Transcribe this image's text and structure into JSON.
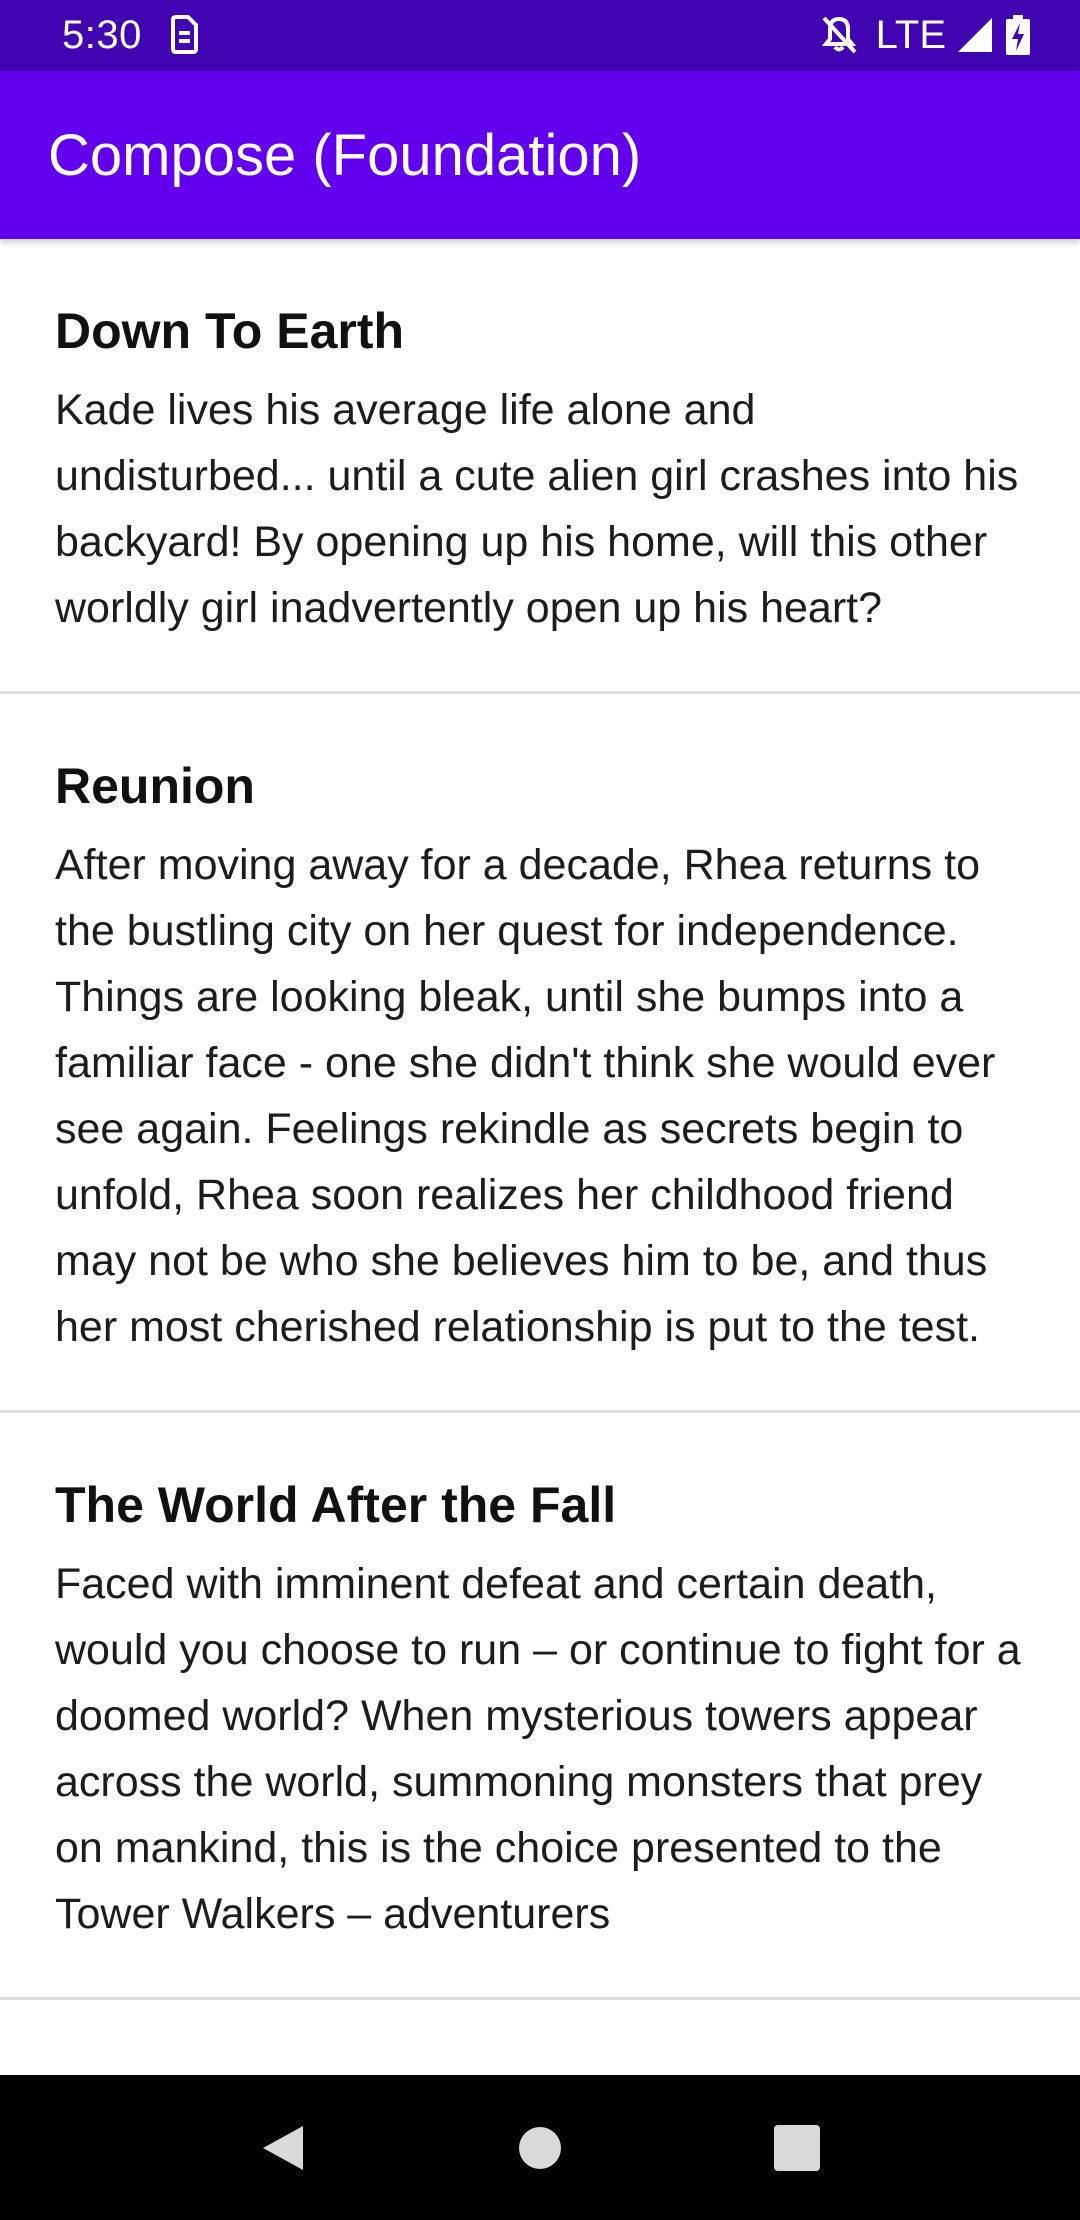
{
  "status_bar": {
    "time": "5:30",
    "network": "LTE",
    "icons": [
      "sim-icon",
      "notifications-off-icon",
      "signal-icon",
      "battery-charging-icon"
    ]
  },
  "app_bar": {
    "title": "Compose (Foundation)"
  },
  "stories": [
    {
      "title": "Down To Earth",
      "description": "Kade lives his average life alone and undisturbed... until a cute alien girl crashes into his backyard! By opening up his home, will this other worldly girl inadvertently open up his heart?"
    },
    {
      "title": "Reunion",
      "description": "After moving away for a decade, Rhea returns to the bustling city on her quest for independence. Things are looking bleak, until she bumps into a familiar face - one she didn't think she would ever see again. Feelings rekindle as secrets begin to unfold, Rhea soon realizes her childhood friend may not be who she believes him to be, and thus her most cherished relationship is put to the test."
    },
    {
      "title": "The World After the Fall",
      "description": "Faced with imminent defeat and certain death, would you choose to run – or continue to fight for a doomed world? When mysterious towers appear across the world, summoning monsters that prey on mankind, this is the choice presented to the Tower Walkers – adventurers"
    }
  ],
  "nav_bar": {
    "buttons": [
      "back-icon",
      "home-icon",
      "recents-icon"
    ]
  },
  "colors": {
    "status_bar": "#4004b0",
    "app_bar": "#6200ee",
    "nav_bar": "#000000",
    "divider": "#dedede"
  }
}
